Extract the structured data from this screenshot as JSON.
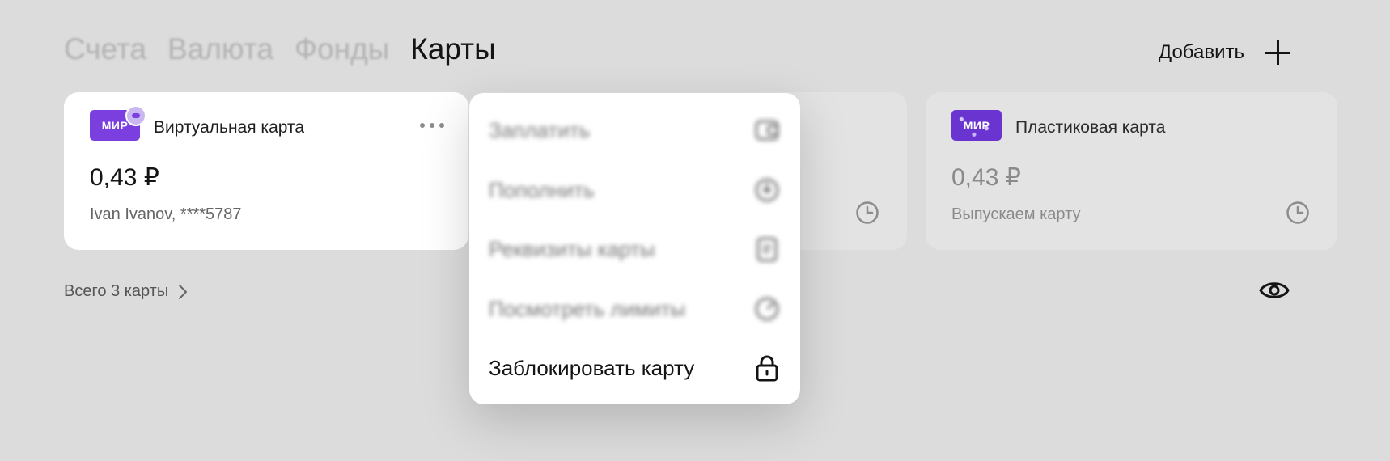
{
  "tabs": [
    {
      "label": "Счета"
    },
    {
      "label": "Валюта"
    },
    {
      "label": "Фонды"
    },
    {
      "label": "Карты"
    }
  ],
  "add_label": "Добавить",
  "cards": [
    {
      "logo": "МИР",
      "name": "Виртуальная карта",
      "balance": "0,43 ₽",
      "sub": "Ivan Ivanov, ****5787"
    },
    {
      "logo": "МИР",
      "name": "Пластиковая карта",
      "balance": "0,43 ₽",
      "sub": "Выпускаем карту"
    }
  ],
  "total_label": "Всего 3 карты",
  "menu": {
    "items": [
      {
        "label": "Заплатить",
        "icon": "wallet-icon"
      },
      {
        "label": "Пополнить",
        "icon": "top-up-icon"
      },
      {
        "label": "Реквизиты карты",
        "icon": "card-details-icon"
      },
      {
        "label": "Посмотреть лимиты",
        "icon": "limits-icon"
      },
      {
        "label": "Заблокировать карту",
        "icon": "lock-icon"
      }
    ]
  },
  "colors": {
    "accent": "#7b3fe0",
    "background": "#dcdcdc"
  }
}
